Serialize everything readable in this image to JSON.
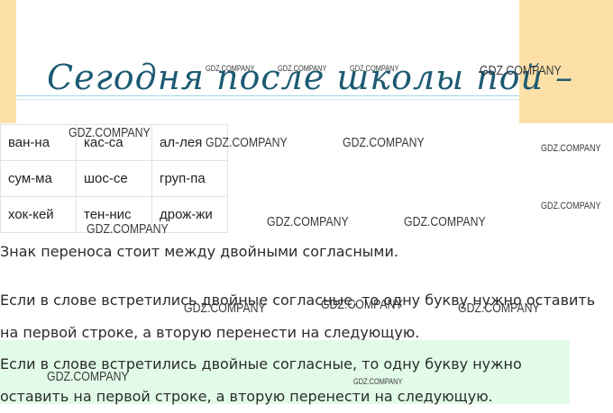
{
  "handwriting": {
    "text": "Сегодня после школы пой –"
  },
  "table": {
    "rows": [
      [
        "ван-на",
        "кас-са",
        "ал-лея"
      ],
      [
        "сум-ма",
        "шос-се",
        "груп-па"
      ],
      [
        "хок-кей",
        "тен-нис",
        "дрож-жи"
      ]
    ]
  },
  "paragraphs": {
    "p1": "Знак переноса стоит между двойными согласными.",
    "p2_line1": "Если в слове встретились двойные согласные, то одну букву нужно оставить",
    "p2_line2": "на первой строке, а вторую перенести на следующую.",
    "p3_line1": "Если в слове встретились двойные согласные, то одну букву нужно",
    "p3_line2": "оставить на первой строке, а вторую перенести на следующую."
  },
  "watermark": {
    "text": "GDZ.COMPANY"
  },
  "colors": {
    "peach": "#fde0a8",
    "highlight_green": "#e2fbe8",
    "handwriting": "#1c5a72"
  }
}
